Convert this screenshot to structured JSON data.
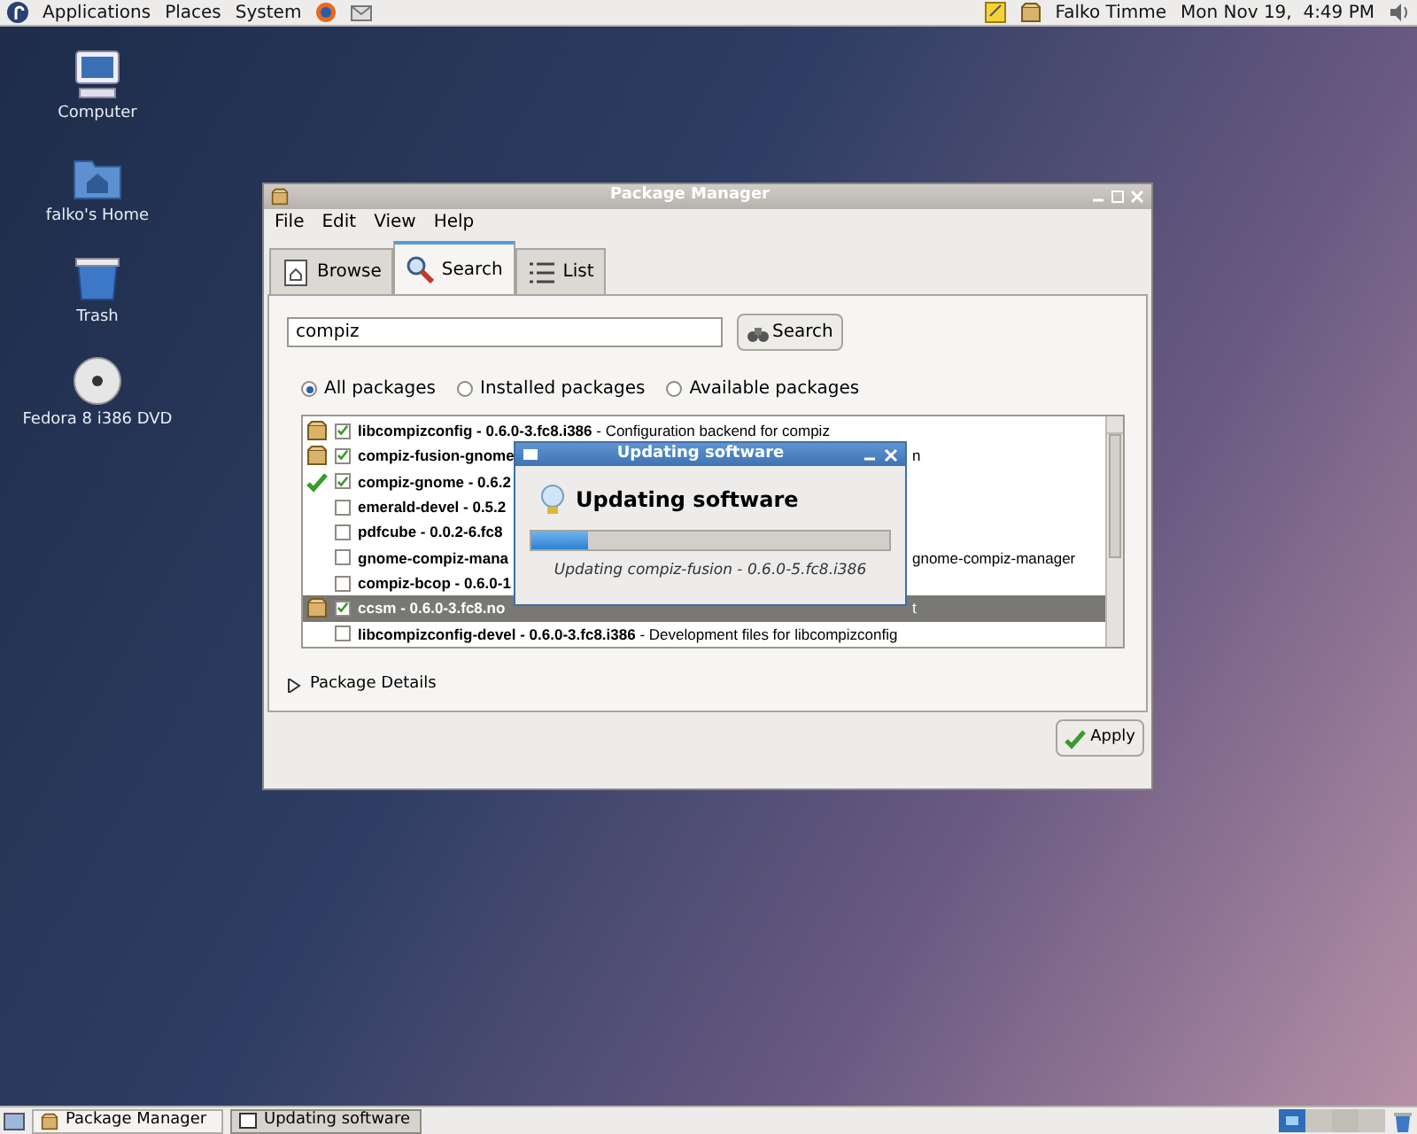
{
  "top_panel": {
    "menus": [
      "Applications",
      "Places",
      "System"
    ],
    "user": "Falko Timme",
    "clock": "Mon Nov 19,  4:49 PM"
  },
  "desktop_icons": [
    {
      "kind": "computer",
      "label": "Computer"
    },
    {
      "kind": "home",
      "label": "falko's Home"
    },
    {
      "kind": "trash",
      "label": "Trash"
    },
    {
      "kind": "disc",
      "label": "Fedora 8 i386 DVD"
    }
  ],
  "window": {
    "title": "Package Manager",
    "menu": [
      "File",
      "Edit",
      "View",
      "Help"
    ],
    "tabs": [
      {
        "kind": "browse",
        "label": "Browse",
        "selected": false
      },
      {
        "kind": "search",
        "label": "Search",
        "selected": true
      },
      {
        "kind": "list",
        "label": "List",
        "selected": false
      }
    ],
    "search": {
      "value": "compiz",
      "button": "Search"
    },
    "filters": [
      {
        "label": "All packages",
        "selected": true
      },
      {
        "label": "Installed packages",
        "selected": false
      },
      {
        "label": "Available packages",
        "selected": false
      }
    ],
    "rows": [
      {
        "kind": "installed",
        "checked": true,
        "selected": false,
        "left": "**libcompizconfig - 0.6.0-3.fc8.i386** - Configuration backend for compiz",
        "right": ""
      },
      {
        "kind": "installed",
        "checked": true,
        "selected": false,
        "left": "**compiz-fusion-gnome**",
        "right": "n"
      },
      {
        "kind": "tick",
        "checked": true,
        "selected": false,
        "left": "**compiz-gnome - 0.6.2**",
        "right": ""
      },
      {
        "kind": "plain",
        "checked": false,
        "selected": false,
        "left": "**emerald-devel - 0.5.2**",
        "right": ""
      },
      {
        "kind": "plain",
        "checked": false,
        "selected": false,
        "left": "**pdfcube - 0.0.2-6.fc8**",
        "right": ""
      },
      {
        "kind": "plain",
        "checked": false,
        "selected": false,
        "left": "**gnome-compiz-mana**",
        "right": "gnome-compiz-manager"
      },
      {
        "kind": "plain",
        "checked": false,
        "selected": false,
        "left": "**compiz-bcop - 0.6.0-1**",
        "right": ""
      },
      {
        "kind": "installed",
        "checked": true,
        "selected": true,
        "left": "**ccsm - 0.6.0-3.fc8.no**",
        "right": "t"
      },
      {
        "kind": "plain",
        "checked": false,
        "selected": false,
        "left": "**libcompizconfig-devel - 0.6.0-3.fc8.i386** - Development files for libcompizconfig",
        "right": ""
      }
    ],
    "details": {
      "label": "Package Details",
      "expanded": false
    },
    "apply": "Apply"
  },
  "dialog": {
    "title": "Updating software",
    "heading": "Updating software",
    "progress": {
      "level": 0.16
    },
    "caption": "Updating compiz-fusion - 0.6.0-5.fc8.i386"
  },
  "taskbar": [
    {
      "kind": "package",
      "label": "Package Manager",
      "selected": false
    },
    {
      "kind": "window",
      "label": "Updating software",
      "selected": true
    }
  ]
}
